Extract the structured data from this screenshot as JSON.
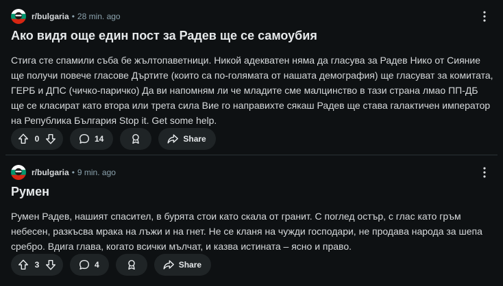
{
  "colors": {
    "background": "#0e1113",
    "pill": "#1f2426",
    "muted_text": "#8ba2ad"
  },
  "posts": [
    {
      "subreddit": "r/bulgaria",
      "separator": "•",
      "time": "28 min. ago",
      "title": "Ако видя още един пост за Радев ще се самоубия",
      "body": "Стига сте спамили съба бе жълтопаветници. Никой адекватен няма да гласува за Радев Нико от Сияние ще получи повече гласове Дъртите (които са по-голямата от нашата демография) ще гласуват за комитата, ГЕРБ и ДПС (чичко-паричко) Да ви напомням ли че младите сме малцинство в тази страна лмао ПП-ДБ ще се класират като втора или трета сила Вие го направихте сякаш Радев ще става галактичен император на Република България Stop it. Get some help.",
      "votes": "0",
      "comments": "14",
      "share_label": "Share",
      "icons": {
        "upvote": "arrow-up-icon",
        "downvote": "arrow-down-icon",
        "comment": "speech-bubble-icon",
        "award": "award-icon",
        "share": "share-arrow-icon",
        "more": "more-vertical-icon"
      }
    },
    {
      "subreddit": "r/bulgaria",
      "separator": "•",
      "time": "9 min. ago",
      "title": "Румен",
      "body": "Румен Радев, нашият спасител, в бурята стои като скала от гранит. С поглед остър, с глас като гръм небесен, разкъсва мрака на лъжи и на гнет. Не се кланя на чужди господари, не продава народа за шепа сребро. Вдига глава, когато всички мълчат, и казва истината – ясно и право.",
      "votes": "3",
      "comments": "4",
      "share_label": "Share",
      "icons": {
        "upvote": "arrow-up-icon",
        "downvote": "arrow-down-icon",
        "comment": "speech-bubble-icon",
        "award": "award-icon",
        "share": "share-arrow-icon",
        "more": "more-vertical-icon"
      }
    }
  ]
}
